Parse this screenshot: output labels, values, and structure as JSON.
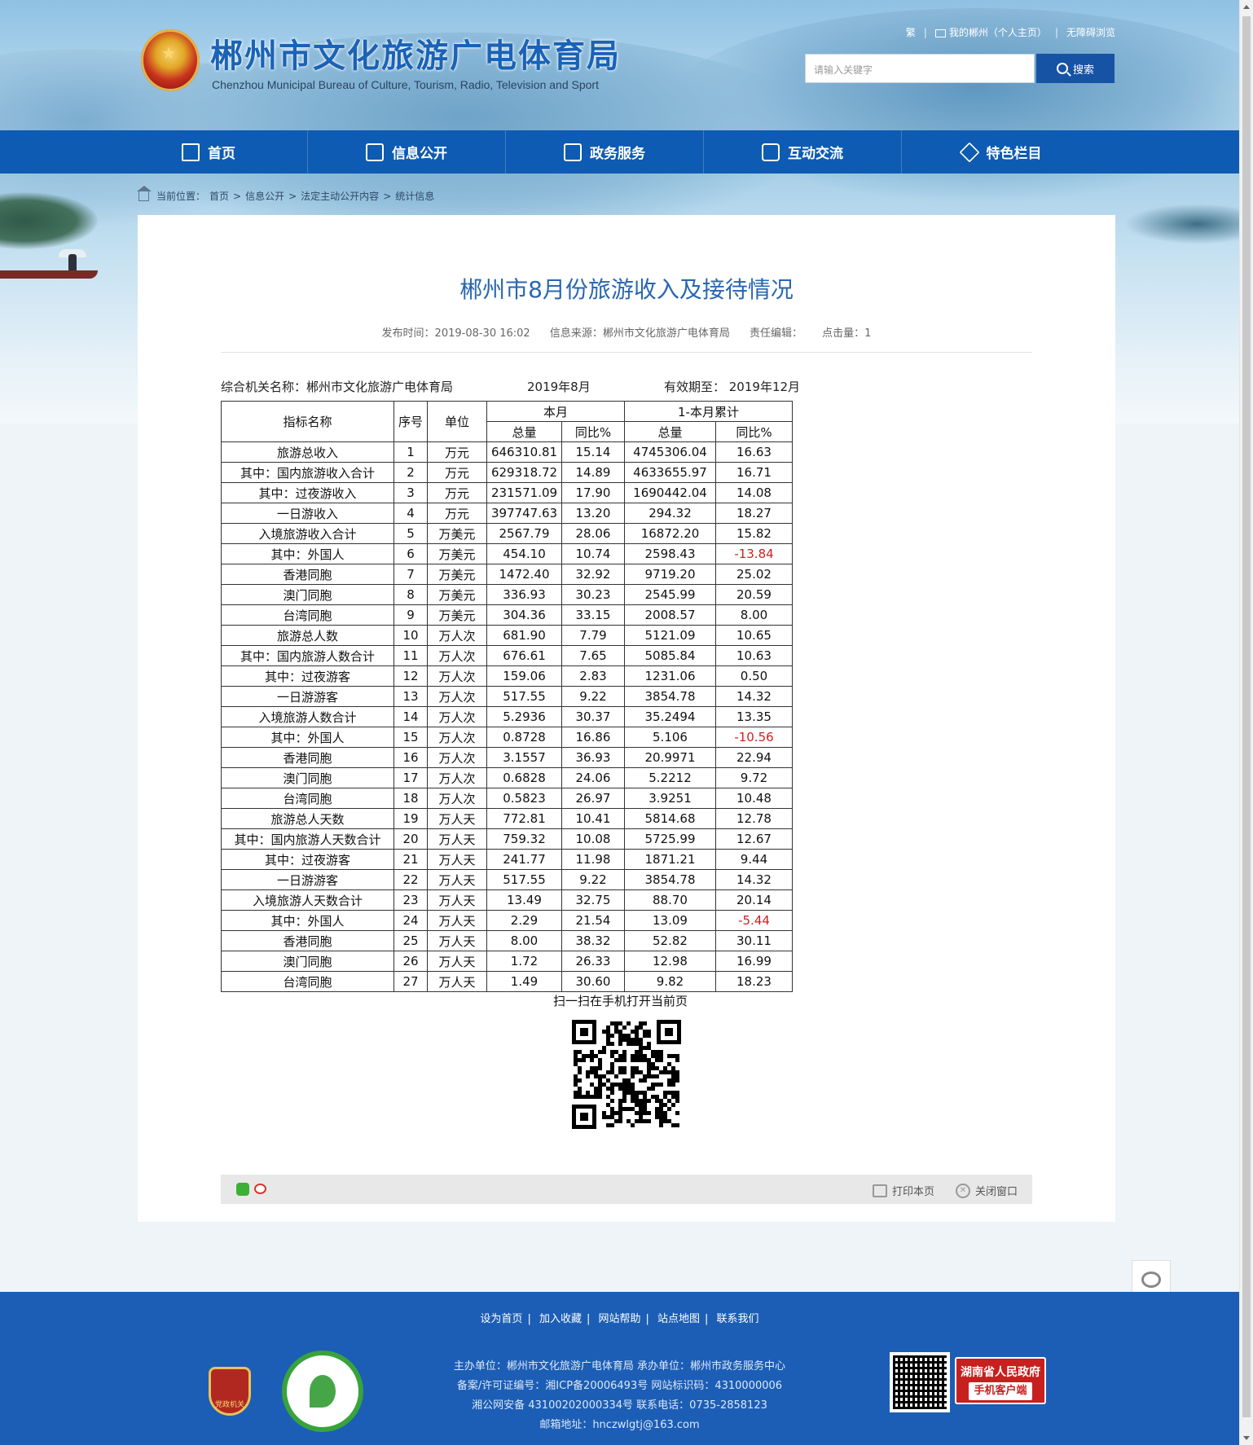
{
  "header": {
    "title": "郴州市文化旅游广电体育局",
    "subtitle": "Chenzhou Municipal Bureau of Culture, Tourism, Radio, Television and Sport",
    "top_links": [
      "繁",
      "我的郴州（个人主页）",
      "无障碍浏览"
    ],
    "search_placeholder": "请输入关键字",
    "search_button": "搜索"
  },
  "nav": [
    {
      "label": "首页",
      "icon": "home-icon"
    },
    {
      "label": "信息公开",
      "icon": "document-icon"
    },
    {
      "label": "政务服务",
      "icon": "edit-icon"
    },
    {
      "label": "互动交流",
      "icon": "chat-icon"
    },
    {
      "label": "特色栏目",
      "icon": "layers-icon"
    }
  ],
  "breadcrumb": {
    "prefix": "当前位置：",
    "items": [
      "首页",
      "信息公开",
      "法定主动公开内容",
      "统计信息"
    ],
    "separator": ">"
  },
  "article": {
    "title": "郴州市8月份旅游收入及接待情况",
    "publish_time": "发布时间：2019-08-30 16:02",
    "source": "信息来源：郴州市文化旅游广电体育局",
    "editor": "责任编辑：",
    "clicks": "点击量：1"
  },
  "table_info": {
    "agency": "综合机关名称：郴州市文化旅游广电体育局",
    "period": "2019年8月",
    "valid_until": "有效期至： 2019年12月"
  },
  "table_headers": {
    "name": "指标名称",
    "no": "序号",
    "unit": "单位",
    "current_month": "本月",
    "cumulative": "1-本月累计",
    "total": "总量",
    "yoy": "同比%"
  },
  "table_rows": [
    {
      "name": "旅游总收入",
      "no": "1",
      "unit": "万元",
      "m_total": "646310.81",
      "m_yoy": "15.14",
      "c_total": "4745306.04",
      "c_yoy": "16.63"
    },
    {
      "name": "其中：国内旅游收入合计",
      "no": "2",
      "unit": "万元",
      "m_total": "629318.72",
      "m_yoy": "14.89",
      "c_total": "4633655.97",
      "c_yoy": "16.71"
    },
    {
      "name": "其中：过夜游收入",
      "no": "3",
      "unit": "万元",
      "m_total": "231571.09",
      "m_yoy": "17.90",
      "c_total": "1690442.04",
      "c_yoy": "14.08"
    },
    {
      "name": "一日游收入",
      "no": "4",
      "unit": "万元",
      "m_total": "397747.63",
      "m_yoy": "13.20",
      "c_total": "294.32",
      "c_yoy": "18.27"
    },
    {
      "name": "入境旅游收入合计",
      "no": "5",
      "unit": "万美元",
      "m_total": "2567.79",
      "m_yoy": "28.06",
      "c_total": "16872.20",
      "c_yoy": "15.82"
    },
    {
      "name": "其中：外国人",
      "no": "6",
      "unit": "万美元",
      "m_total": "454.10",
      "m_yoy": "10.74",
      "c_total": "2598.43",
      "c_yoy": "-13.84"
    },
    {
      "name": "香港同胞",
      "no": "7",
      "unit": "万美元",
      "m_total": "1472.40",
      "m_yoy": "32.92",
      "c_total": "9719.20",
      "c_yoy": "25.02"
    },
    {
      "name": "澳门同胞",
      "no": "8",
      "unit": "万美元",
      "m_total": "336.93",
      "m_yoy": "30.23",
      "c_total": "2545.99",
      "c_yoy": "20.59"
    },
    {
      "name": "台湾同胞",
      "no": "9",
      "unit": "万美元",
      "m_total": "304.36",
      "m_yoy": "33.15",
      "c_total": "2008.57",
      "c_yoy": "8.00"
    },
    {
      "name": "旅游总人数",
      "no": "10",
      "unit": "万人次",
      "m_total": "681.90",
      "m_yoy": "7.79",
      "c_total": "5121.09",
      "c_yoy": "10.65"
    },
    {
      "name": "其中：国内旅游人数合计",
      "no": "11",
      "unit": "万人次",
      "m_total": "676.61",
      "m_yoy": "7.65",
      "c_total": "5085.84",
      "c_yoy": "10.63"
    },
    {
      "name": "其中：过夜游客",
      "no": "12",
      "unit": "万人次",
      "m_total": "159.06",
      "m_yoy": "2.83",
      "c_total": "1231.06",
      "c_yoy": "0.50"
    },
    {
      "name": "一日游游客",
      "no": "13",
      "unit": "万人次",
      "m_total": "517.55",
      "m_yoy": "9.22",
      "c_total": "3854.78",
      "c_yoy": "14.32"
    },
    {
      "name": "入境旅游人数合计",
      "no": "14",
      "unit": "万人次",
      "m_total": "5.2936",
      "m_yoy": "30.37",
      "c_total": "35.2494",
      "c_yoy": "13.35"
    },
    {
      "name": "其中：外国人",
      "no": "15",
      "unit": "万人次",
      "m_total": "0.8728",
      "m_yoy": "16.86",
      "c_total": "5.106",
      "c_yoy": "-10.56"
    },
    {
      "name": "香港同胞",
      "no": "16",
      "unit": "万人次",
      "m_total": "3.1557",
      "m_yoy": "36.93",
      "c_total": "20.9971",
      "c_yoy": "22.94"
    },
    {
      "name": "澳门同胞",
      "no": "17",
      "unit": "万人次",
      "m_total": "0.6828",
      "m_yoy": "24.06",
      "c_total": "5.2212",
      "c_yoy": "9.72"
    },
    {
      "name": "台湾同胞",
      "no": "18",
      "unit": "万人次",
      "m_total": "0.5823",
      "m_yoy": "26.97",
      "c_total": "3.9251",
      "c_yoy": "10.48"
    },
    {
      "name": "旅游总人天数",
      "no": "19",
      "unit": "万人天",
      "m_total": "772.81",
      "m_yoy": "10.41",
      "c_total": "5814.68",
      "c_yoy": "12.78"
    },
    {
      "name": "其中：国内旅游人天数合计",
      "no": "20",
      "unit": "万人天",
      "m_total": "759.32",
      "m_yoy": "10.08",
      "c_total": "5725.99",
      "c_yoy": "12.67"
    },
    {
      "name": "其中：过夜游客",
      "no": "21",
      "unit": "万人天",
      "m_total": "241.77",
      "m_yoy": "11.98",
      "c_total": "1871.21",
      "c_yoy": "9.44"
    },
    {
      "name": "一日游游客",
      "no": "22",
      "unit": "万人天",
      "m_total": "517.55",
      "m_yoy": "9.22",
      "c_total": "3854.78",
      "c_yoy": "14.32"
    },
    {
      "name": "入境旅游人天数合计",
      "no": "23",
      "unit": "万人天",
      "m_total": "13.49",
      "m_yoy": "32.75",
      "c_total": "88.70",
      "c_yoy": "20.14"
    },
    {
      "name": "其中：外国人",
      "no": "24",
      "unit": "万人天",
      "m_total": "2.29",
      "m_yoy": "21.54",
      "c_total": "13.09",
      "c_yoy": "-5.44"
    },
    {
      "name": "香港同胞",
      "no": "25",
      "unit": "万人天",
      "m_total": "8.00",
      "m_yoy": "38.32",
      "c_total": "52.82",
      "c_yoy": "30.11"
    },
    {
      "name": "澳门同胞",
      "no": "26",
      "unit": "万人天",
      "m_total": "1.72",
      "m_yoy": "26.33",
      "c_total": "12.98",
      "c_yoy": "16.99"
    },
    {
      "name": "台湾同胞",
      "no": "27",
      "unit": "万人天",
      "m_total": "1.49",
      "m_yoy": "30.60",
      "c_total": "9.82",
      "c_yoy": "18.23"
    }
  ],
  "qr_caption": "扫一扫在手机打开当前页",
  "toolbar": {
    "print": "打印本页",
    "close": "关闭窗口"
  },
  "footer": {
    "links": [
      "设为首页",
      "加入收藏",
      "网站帮助",
      "站点地图",
      "联系我们"
    ],
    "sponsor": "主办单位：郴州市文化旅游广电体育局   承办单位：郴州市政务服务中心",
    "icp": "备案/许可证编号：湘ICP备20006493号   网站标识码：4310000006",
    "police": "湘公网安备 43100202000334号   联系电话：0735-2858123",
    "email": "邮箱地址：hnczwlgtj@163.com",
    "badge_dangzheng": "党政机关",
    "app_title": "湖南省人民政府",
    "app_sub": "手机客户端"
  },
  "colors": {
    "brand_blue": "#0e5bb3",
    "title_blue": "#2a67b0",
    "negative_red": "#d21e1e"
  }
}
